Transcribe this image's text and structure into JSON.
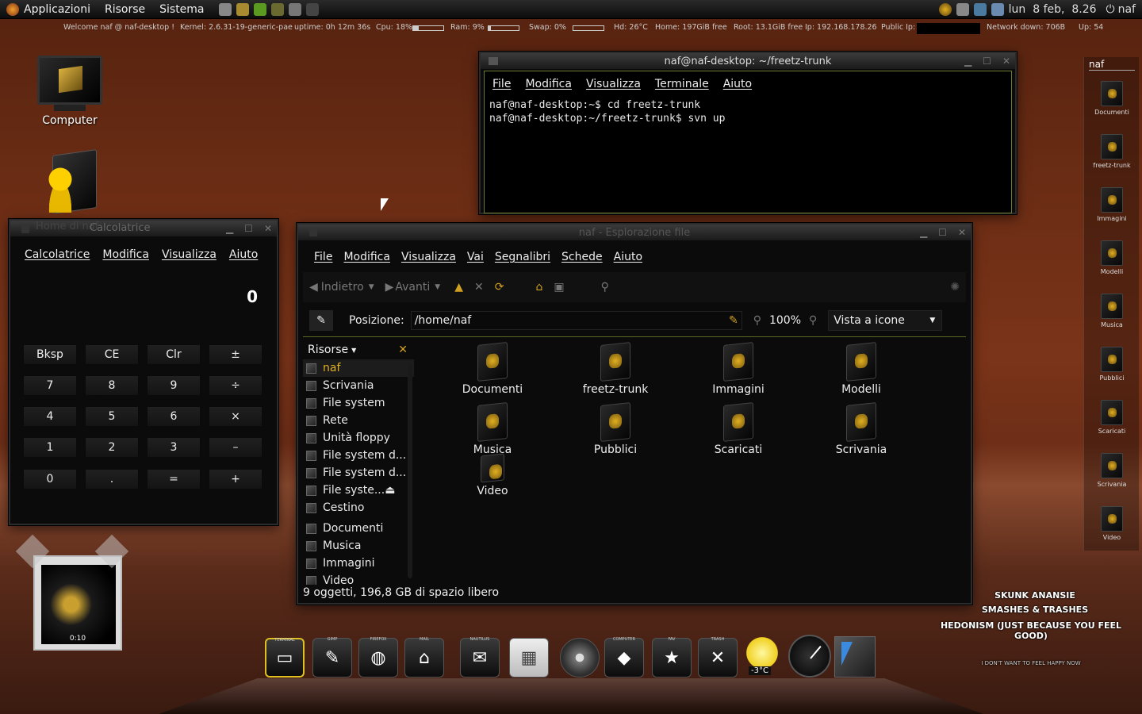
{
  "top_panel": {
    "menus": [
      "Applicazioni",
      "Risorse",
      "Sistema"
    ],
    "datetime": "lun  8 feb,  8.26",
    "user": "naf"
  },
  "conky": {
    "welcome": "Welcome naf @ naf-desktop !",
    "kernel": "Kernel: 2.6.31-19-generic-pae",
    "uptime": "uptime: 0h 12m 36s",
    "cpu": "Cpu: 18%",
    "cpu_level": 0.18,
    "ram": "Ram: 9%",
    "ram_level": 0.09,
    "swap": "Swap: 0%",
    "swap_level": 0.0,
    "hd": "Hd: 26°C",
    "home": "Home: 197GiB free",
    "root": "Root: 13.1GiB free",
    "ip": "Ip: 192.168.178.26",
    "public_ip": "Public Ip:",
    "net_down": "Network down: 706B",
    "net_up": "Up: 54"
  },
  "desktop_icons": {
    "computer": "Computer"
  },
  "terminal": {
    "title": "naf@naf-desktop: ~/freetz-trunk",
    "menu": [
      "File",
      "Modifica",
      "Visualizza",
      "Terminale",
      "Aiuto"
    ],
    "lines": [
      "naf@naf-desktop:~$ cd freetz-trunk",
      "naf@naf-desktop:~/freetz-trunk$ svn up"
    ]
  },
  "calculator": {
    "title": "Calcolatrice",
    "behind_title": "Home di naf",
    "menu": [
      "Calcolatrice",
      "Modifica",
      "Visualizza",
      "Aiuto"
    ],
    "display": "0",
    "keys": [
      [
        "Bksp",
        "CE",
        "Clr",
        "±"
      ],
      [
        "7",
        "8",
        "9",
        "÷"
      ],
      [
        "4",
        "5",
        "6",
        "×"
      ],
      [
        "1",
        "2",
        "3",
        "–"
      ],
      [
        "0",
        ".",
        "=",
        "+"
      ]
    ]
  },
  "file_manager": {
    "title": "naf - Esplorazione file",
    "menu": [
      "File",
      "Modifica",
      "Visualizza",
      "Vai",
      "Segnalibri",
      "Schede",
      "Aiuto"
    ],
    "back": "Indietro",
    "forward": "Avanti",
    "location_label": "Posizione:",
    "location": "/home/naf",
    "zoom": "100%",
    "view_mode": "Vista a icone",
    "sidebar_title": "Risorse",
    "sidebar_items": [
      "naf",
      "Scrivania",
      "File system",
      "Rete",
      "Unità floppy",
      "File system d...",
      "File system d...",
      "File syste...",
      "Cestino",
      "Documenti",
      "Musica",
      "Immagini",
      "Video"
    ],
    "items": [
      "Documenti",
      "freetz-trunk",
      "Immagini",
      "Modelli",
      "Musica",
      "Pubblici",
      "Scaricati",
      "Scrivania",
      "Video"
    ],
    "status": "9 oggetti, 196,8 GB di spazio libero"
  },
  "right_bar": {
    "title": "naf",
    "items": [
      "Documenti",
      "freetz-trunk",
      "Immagini",
      "Modelli",
      "Musica",
      "Pubblici",
      "Scaricati",
      "Scrivania",
      "Video"
    ]
  },
  "media_widget": {
    "time": "0:10"
  },
  "dock": {
    "labels": [
      "TERMINAL",
      "GIMP",
      "FIREFOX",
      "MAIL",
      "NAUTILUS",
      "COMPUTER",
      "FAV",
      "TRASH"
    ],
    "weather": "-3°C"
  },
  "lyrics": {
    "line1": "SKUNK ANANSIE",
    "line2": "SMASHES & TRASHES",
    "line3": "HEDONISM (JUST BECAUSE YOU FEEL GOOD)",
    "line4": "I DON'T WANT TO FEEL HAPPY NOW"
  }
}
